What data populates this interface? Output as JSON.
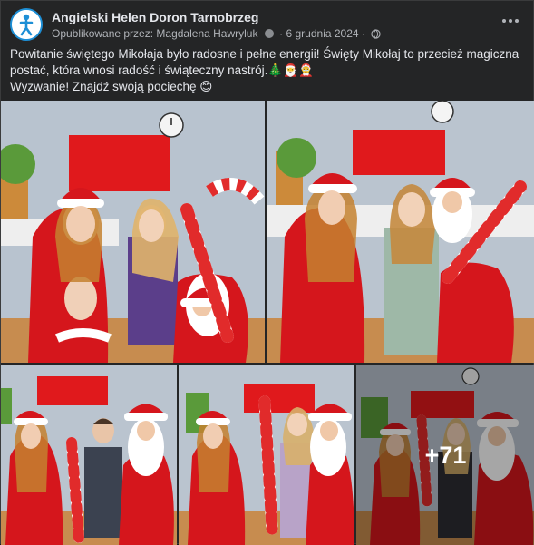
{
  "post": {
    "page_name": "Angielski Helen Doron Tarnobrzeg",
    "published_by_label": "Opublikowane przez:",
    "author": "Magdalena Hawryluk",
    "date_separator": "·",
    "date": "6 grudnia 2024",
    "more_options_icon": "more-horizontal-icon",
    "privacy_icon": "globe-icon"
  },
  "content": {
    "line1": "Powitanie świętego Mikołaja było radosne i pełne energii! Święty Mikołaj to przecież magiczna postać, która wnosi radość i świąteczny nastrój.🎄🎅🤶",
    "line2": "Wyzwanie! Znajdź swoją pociechę 😊"
  },
  "photos": {
    "more_count": "+71"
  }
}
